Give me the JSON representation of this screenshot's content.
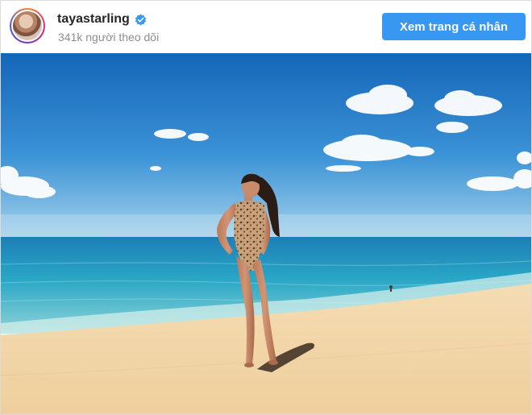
{
  "post": {
    "username": "tayastarling",
    "followers_text": "341k người theo dõi",
    "view_profile_label": "Xem trang cá nhân"
  },
  "icons": {
    "verified": "verified-badge-icon",
    "avatar": "profile-avatar"
  },
  "colors": {
    "button": "#3897f0",
    "verified": "#3897f0",
    "sky": "#1f78c8",
    "sea": "#2aa5c5",
    "sand": "#f1d5a8"
  }
}
